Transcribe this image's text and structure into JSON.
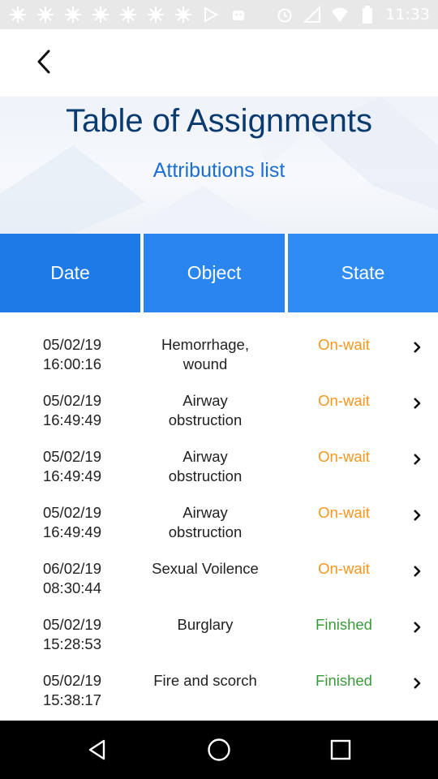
{
  "status_bar": {
    "time": "11:33",
    "left_icons": [
      "notification-icon",
      "notification-icon",
      "notification-icon",
      "notification-icon",
      "notification-icon",
      "notification-icon",
      "notification-icon",
      "play-store-icon",
      "android-icon"
    ],
    "right_icons": [
      "alarm-icon",
      "signal-icon",
      "wifi-icon",
      "battery-icon"
    ]
  },
  "header": {
    "title": "Table of Assignments",
    "subtitle": "Attributions list"
  },
  "table": {
    "columns": [
      "Date",
      "Object",
      "State"
    ],
    "rows": [
      {
        "date": "05/02/19",
        "time": "16:00:16",
        "object_line1": "Hemorrhage,",
        "object_line2": "wound",
        "state": "On-wait"
      },
      {
        "date": "05/02/19",
        "time": "16:49:49",
        "object_line1": "Airway",
        "object_line2": "obstruction",
        "state": "On-wait"
      },
      {
        "date": "05/02/19",
        "time": "16:49:49",
        "object_line1": "Airway",
        "object_line2": "obstruction",
        "state": "On-wait"
      },
      {
        "date": "05/02/19",
        "time": "16:49:49",
        "object_line1": "Airway",
        "object_line2": "obstruction",
        "state": "On-wait"
      },
      {
        "date": "06/02/19",
        "time": "08:30:44",
        "object_line1": "Sexual Voilence",
        "object_line2": "",
        "state": "On-wait"
      },
      {
        "date": "05/02/19",
        "time": "15:28:53",
        "object_line1": "Burglary",
        "object_line2": "",
        "state": "Finished"
      },
      {
        "date": "05/02/19",
        "time": "15:38:17",
        "object_line1": "Fire and scorch",
        "object_line2": "",
        "state": "Finished"
      }
    ]
  },
  "colors": {
    "title": "#0a3a6e",
    "subtitle": "#1c6fd0",
    "header_date": "#1d7ae6",
    "header_object": "#2b85f0",
    "header_state": "#2f8cf5",
    "state_wait": "#f5961e",
    "state_finished": "#3a9a3a"
  }
}
